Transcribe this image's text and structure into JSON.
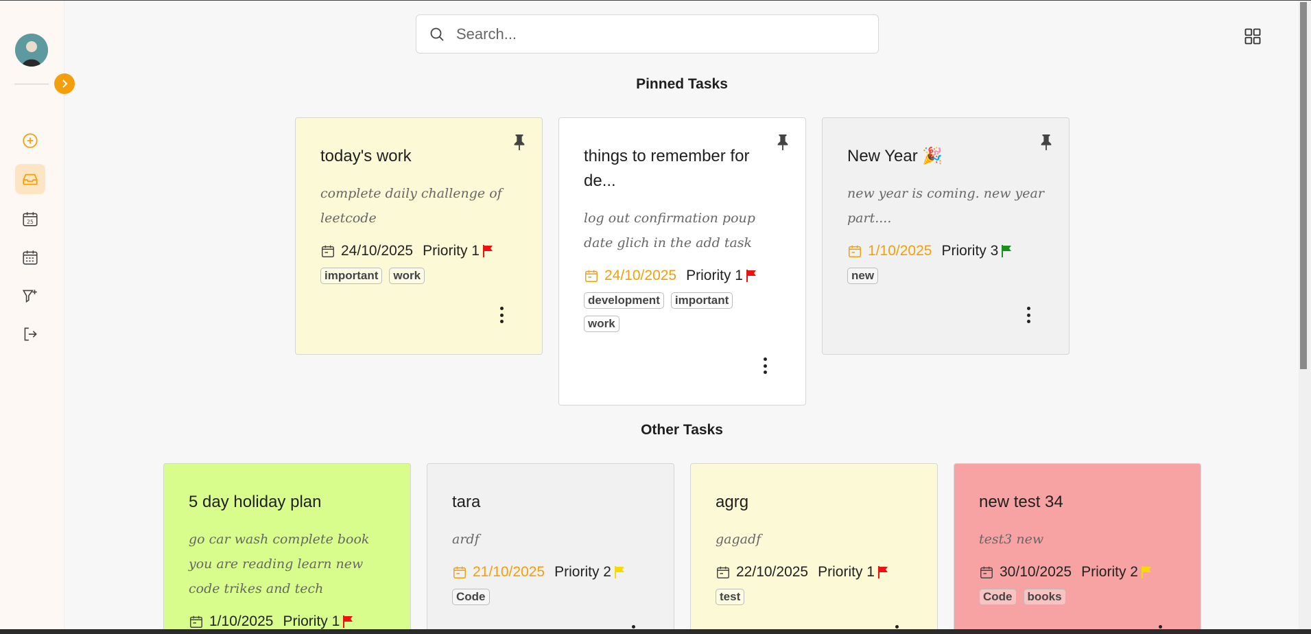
{
  "search": {
    "placeholder": "Search..."
  },
  "sections": {
    "pinned": "Pinned Tasks",
    "other": "Other Tasks"
  },
  "colors": {
    "accent": "#f59e0b",
    "flag_red": "#e11",
    "flag_green": "#1a8f1a",
    "flag_yellow": "#f5d90a"
  },
  "pinned": [
    {
      "title": "today's work",
      "desc": "complete daily challenge of leetcode",
      "date": "24/10/2025",
      "priority": "Priority 1",
      "tags": [
        "important",
        "work"
      ]
    },
    {
      "title": "things to remember for de...",
      "desc": "log out confirmation poup date glich in the add task",
      "date": "24/10/2025",
      "priority": "Priority 1",
      "tags": [
        "development",
        "important",
        "work"
      ]
    },
    {
      "title": "New Year 🎉",
      "desc": "new year is coming. new year part....",
      "date": "1/10/2025",
      "priority": "Priority 3",
      "tags": [
        "new"
      ]
    }
  ],
  "other": [
    {
      "title": "5 day holiday plan",
      "desc": "go car wash complete book you are reading learn new code trikes and tech",
      "date": "1/10/2025",
      "priority": "Priority 1"
    },
    {
      "title": "tara",
      "desc": "ardf",
      "date": "21/10/2025",
      "priority": "Priority 2",
      "tags": [
        "Code"
      ]
    },
    {
      "title": "agrg",
      "desc": "gagadf",
      "date": "22/10/2025",
      "priority": "Priority 1",
      "tags": [
        "test"
      ]
    },
    {
      "title": "new test 34",
      "desc": "test3 new",
      "date": "30/10/2025",
      "priority": "Priority 2",
      "tags": [
        "Code",
        "books"
      ]
    }
  ]
}
